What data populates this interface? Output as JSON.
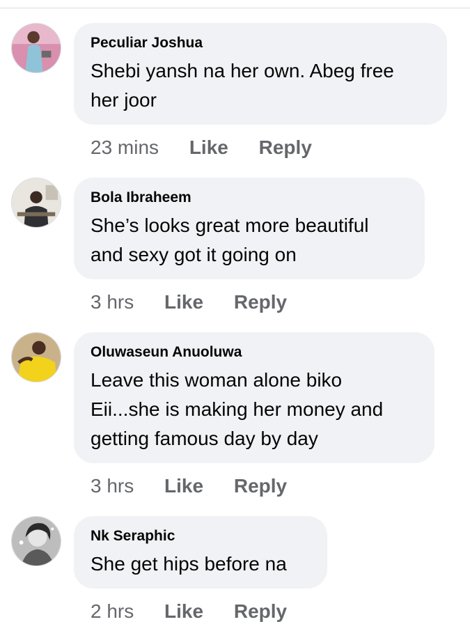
{
  "comments": [
    {
      "author": "Peculiar Joshua",
      "text": "Shebi yansh na her own. Abeg free\nher joor",
      "time": "23 mins",
      "like_label": "Like",
      "reply_label": "Reply",
      "avatar_colors": {
        "bg": "#d98fae",
        "accent": "#8fc4d8"
      }
    },
    {
      "author": "Bola Ibraheem",
      "text": "She’s looks great more beautiful\nand sexy got it going on",
      "time": "3 hrs",
      "like_label": "Like",
      "reply_label": "Reply",
      "avatar_colors": {
        "bg": "#e9e6df",
        "accent": "#2f3033"
      }
    },
    {
      "author": "Oluwaseun Anuoluwa",
      "text": "Leave this woman alone biko\nEii...she is making her money and\ngetting famous day by day",
      "time": "3 hrs",
      "like_label": "Like",
      "reply_label": "Reply",
      "avatar_colors": {
        "bg": "#c9b28a",
        "accent": "#f2d21b"
      }
    },
    {
      "author": "Nk Seraphic",
      "text": "She get hips before na",
      "time": "2 hrs",
      "like_label": "Like",
      "reply_label": "Reply",
      "avatar_colors": {
        "bg": "#bdbdbd",
        "accent": "#2a2a2a"
      }
    }
  ]
}
